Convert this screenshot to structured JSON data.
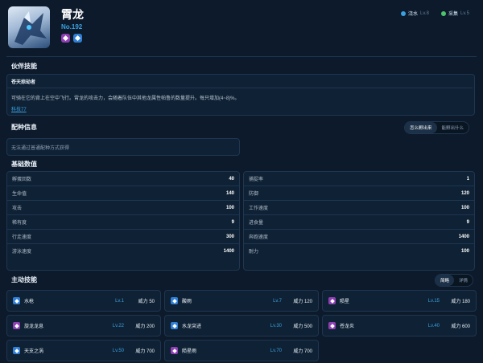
{
  "header": {
    "name": "霄龙",
    "number": "No.192",
    "types": [
      {
        "icon": "dragon-type-icon",
        "color": "#8e3fb3"
      },
      {
        "icon": "water-type-icon",
        "color": "#2f7fd6"
      }
    ],
    "works": [
      {
        "name": "浇水",
        "level": "Lv.8",
        "color": "#3aa0e0"
      },
      {
        "name": "采集",
        "level": "Lv.5",
        "color": "#4cc46a"
      }
    ]
  },
  "partner": {
    "title": "伙伴技能",
    "skill_name": "苍天掠劫者",
    "description": "可骑在它的背上在空中飞行。霄龙的攻击力，会随着队伍中其他龙属性帕鲁的数量提升。每只增加(4~8)%。",
    "tech": "科技77"
  },
  "breeding": {
    "title": "配种信息",
    "tabs": [
      "怎么孵出来",
      "能孵出什么"
    ],
    "text": "无法通过普通配种方式获得"
  },
  "stats": {
    "title": "基础数值",
    "left": [
      {
        "label": "孵蛋回数",
        "value": "40"
      },
      {
        "label": "生命值",
        "value": "140"
      },
      {
        "label": "攻击",
        "value": "100"
      },
      {
        "label": "稀有度",
        "value": "9"
      },
      {
        "label": "行走速度",
        "value": "300"
      },
      {
        "label": "游泳速度",
        "value": "1400"
      }
    ],
    "right": [
      {
        "label": "捕捉率",
        "value": "1"
      },
      {
        "label": "防御",
        "value": "120"
      },
      {
        "label": "工作速度",
        "value": "100"
      },
      {
        "label": "进食量",
        "value": "9"
      },
      {
        "label": "奔跑速度",
        "value": "1400"
      },
      {
        "label": "耐力",
        "value": "100"
      }
    ]
  },
  "skills": {
    "title": "主动技能",
    "tabs": [
      "简略",
      "详情"
    ],
    "power_label": "威力",
    "items": [
      {
        "name": "水枪",
        "level": "Lv.1",
        "power": "威力 50",
        "type": "water"
      },
      {
        "name": "酸雨",
        "level": "Lv.7",
        "power": "威力 120",
        "type": "water"
      },
      {
        "name": "陨星",
        "level": "Lv.15",
        "power": "威力 180",
        "type": "dragon"
      },
      {
        "name": "旋龙龙息",
        "level": "Lv.22",
        "power": "威力 200",
        "type": "dragon"
      },
      {
        "name": "水龙突进",
        "level": "Lv.30",
        "power": "威力 500",
        "type": "water"
      },
      {
        "name": "苍龙炎",
        "level": "Lv.40",
        "power": "威力 600",
        "type": "dragon"
      },
      {
        "name": "天支之涡",
        "level": "Lv.50",
        "power": "威力 700",
        "type": "water"
      },
      {
        "name": "陨星雨",
        "level": "Lv.70",
        "power": "威力 700",
        "type": "dragon"
      }
    ]
  },
  "colors": {
    "dragon": "#8e3fb3",
    "water": "#2f7fd6",
    "accent": "#3aa0e0",
    "bg": "#0d1a2b"
  }
}
